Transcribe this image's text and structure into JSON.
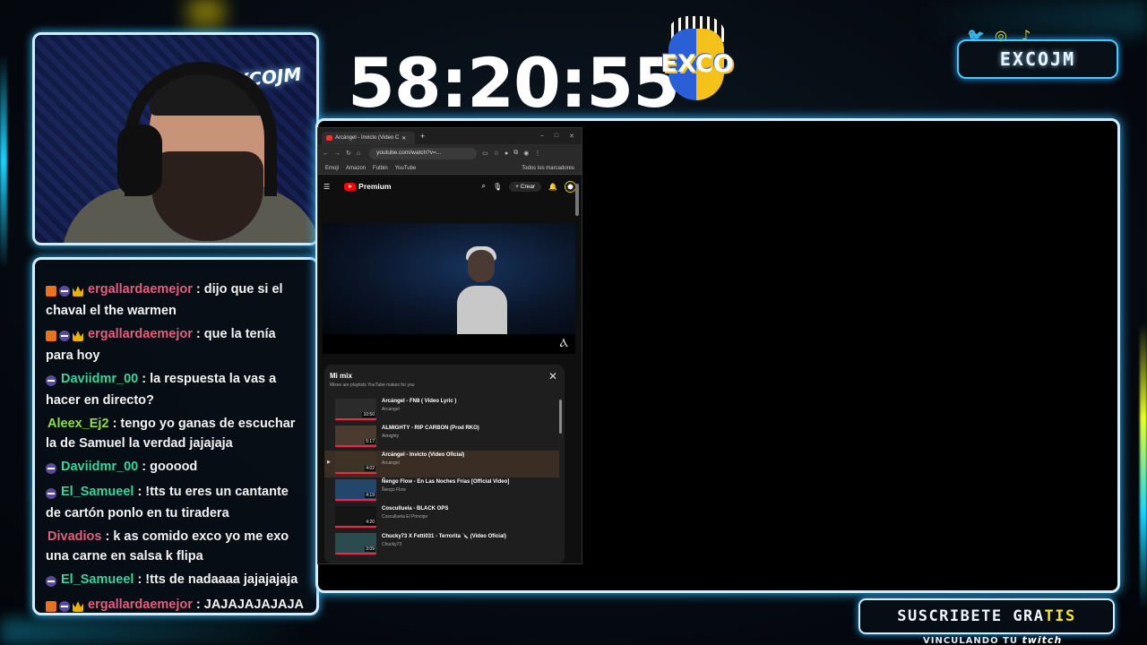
{
  "timer": "58:20:55",
  "logo": {
    "text": "EXCO"
  },
  "webcam": {
    "wall_logo": "EXCOJM"
  },
  "channel": {
    "name": "EXCOJM",
    "social_icons": [
      "twitter-icon",
      "instagram-icon",
      "tiktok-icon"
    ]
  },
  "subscribe": {
    "label_a": "SUSCRIBETE GRA",
    "label_b": "TIS",
    "linking": "VINCULANDO TU",
    "platform": "twitch"
  },
  "colors": {
    "accent_cyan": "#34b8ff",
    "accent_yellow": "#f2e72a",
    "username_pink": "#e0607e",
    "username_green": "#37d49b",
    "username_lime": "#8bde49"
  },
  "chat": {
    "messages": [
      {
        "badges": [
          "box",
          "mod",
          "crown"
        ],
        "user": "ergallardaemejor",
        "color": "#e0607e",
        "text": ": dijo que si el chaval el the warmen"
      },
      {
        "badges": [
          "box",
          "mod",
          "crown"
        ],
        "user": "ergallardaemejor",
        "color": "#e0607e",
        "text": ": que la tenía para hoy"
      },
      {
        "badges": [
          "mod"
        ],
        "user": "Daviidmr_00",
        "color": "#37d49b",
        "text": ": la respuesta la vas a hacer en directo?"
      },
      {
        "badges": [],
        "user": "Aleex_Ej2",
        "color": "#8bde49",
        "text": ": tengo yo ganas de escuchar la de Samuel la verdad jajajaja"
      },
      {
        "badges": [
          "mod"
        ],
        "user": "Daviidmr_00",
        "color": "#37d49b",
        "text": ": gooood"
      },
      {
        "badges": [
          "mod"
        ],
        "user": "El_Samueel",
        "color": "#37d49b",
        "text": ": !tts tu eres un cantante de cartón ponlo en tu tiradera"
      },
      {
        "badges": [],
        "user": "Divadios",
        "color": "#e0607e",
        "text": ": k as comido exco yo me exo una carne en salsa k flipa"
      },
      {
        "badges": [
          "mod"
        ],
        "user": "El_Samueel",
        "color": "#37d49b",
        "text": ": !tts de nadaaaa jajajajaja"
      },
      {
        "badges": [
          "box",
          "mod",
          "crown"
        ],
        "user": "ergallardaemejor",
        "color": "#e0607e",
        "text": ": JAJAJAJAJAJA"
      }
    ]
  },
  "browser": {
    "tab_title": "Arcángel - Invicto (Video C",
    "url": "youtube.com/watch?v=...",
    "bookmarks": [
      "Emoji",
      "Amazon",
      "Futbin",
      "YouTube"
    ],
    "all_bookmarks": "Todos los marcadores",
    "youtube": {
      "brand": "Premium",
      "create_label": "Crear",
      "mix_title": "Mi mix",
      "mix_subtitle": "Mixes are playlists YouTube makes for you",
      "tracks": [
        {
          "title": "Arcángel - FN8 ( Video Lyric )",
          "artist": "Arcangel",
          "duration": "10:50"
        },
        {
          "title": "ALMIGHTY - RIP CARBON (Prod RKO)",
          "artist": "Almighty",
          "duration": "5:17"
        },
        {
          "title": "Arcángel - Invicto (Video Oficial)",
          "artist": "Arcangel",
          "duration": "4:02",
          "active": true
        },
        {
          "title": "Ñengo Flow - En Las Noches Frías [Official Video]",
          "artist": "Ñengo Flow",
          "duration": "4:19"
        },
        {
          "title": "Cosculluela - BLACK OPS",
          "artist": "Cosculluela El Principe",
          "duration": "4:20"
        },
        {
          "title": "Chucky73 X Fetti031 - Terrorita 🔪 (Video Oficial)",
          "artist": "Chucky73",
          "duration": "3:09"
        }
      ]
    }
  }
}
